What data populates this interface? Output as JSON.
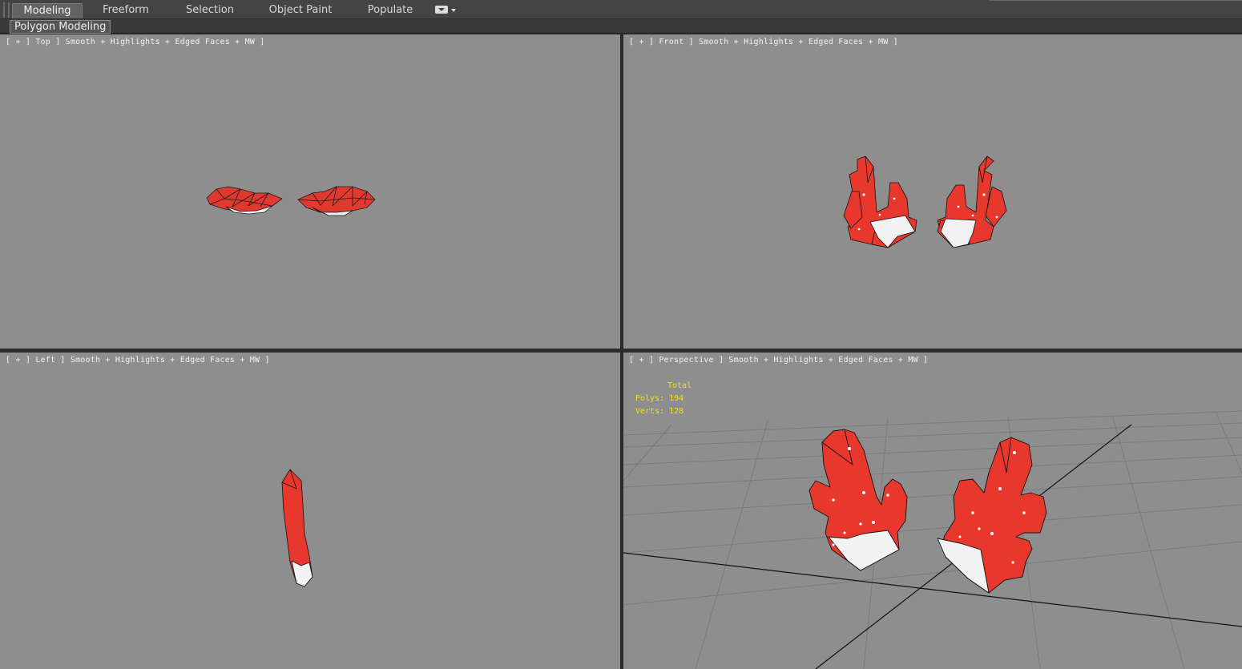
{
  "ribbon": {
    "tabs": [
      {
        "label": "Modeling"
      },
      {
        "label": "Freeform"
      },
      {
        "label": "Selection"
      },
      {
        "label": "Object Paint"
      },
      {
        "label": "Populate"
      }
    ]
  },
  "panel": {
    "label": "Polygon Modeling"
  },
  "viewports": {
    "top": {
      "label": "[ + ] Top ] Smooth + Highlights + Edged Faces + MW ]"
    },
    "front": {
      "label": "[ + ] Front ] Smooth + Highlights + Edged Faces + MW ]"
    },
    "left": {
      "label": "[ + ] Left ] Smooth + Highlights + Edged Faces + MW ]"
    },
    "perspective": {
      "label": "[ + ] Perspective ] Smooth + Highlights + Edged Faces + MW ]"
    }
  },
  "stats": {
    "title": "Total",
    "polys": "Polys: 194",
    "verts": "Verts: 128"
  },
  "colors": {
    "viewport_bg": "#8e8e8e",
    "glove_red": "#e8382e",
    "glove_white": "#f2f2f2",
    "stats_yellow": "#f2e400"
  }
}
